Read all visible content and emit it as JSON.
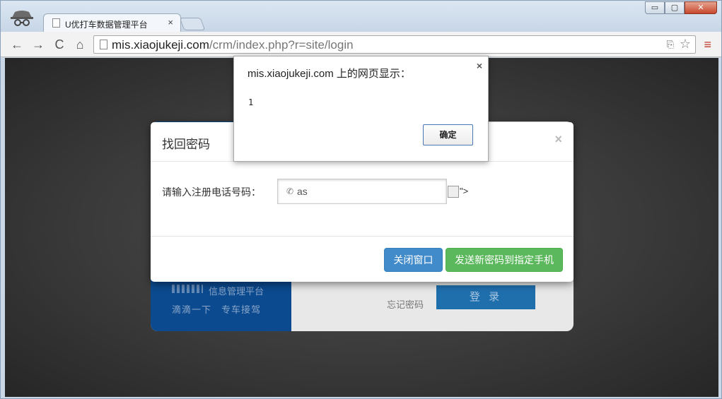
{
  "browser": {
    "tab_title": "U优打车数据管理平台",
    "tab_close": "×",
    "window_buttons": {
      "minimize": "▭",
      "maximize": "▢",
      "close": "✕"
    },
    "url_host": "mis.xiaojukeji.com",
    "url_path": "/crm/index.php?r=site/login",
    "nav": {
      "back": "←",
      "forward": "→",
      "reload": "C",
      "home": "⌂"
    },
    "star": "☆",
    "translate": "⎘",
    "menu": "≡"
  },
  "login": {
    "brand_line1": "信息管理平台",
    "brand_line2": "滴滴一下　专车接驾",
    "forgot_link": "忘记密码",
    "login_button": "登 录"
  },
  "modal": {
    "title": "找回密码",
    "close": "×",
    "phone_label": "请输入注册电话号码：",
    "phone_icon": "✆",
    "phone_value": "as",
    "stray_text": "\">",
    "btn_close": "关闭窗口",
    "btn_send": "发送新密码到指定手机"
  },
  "alert": {
    "title": "mis.xiaojukeji.com 上的网页显示：",
    "close": "×",
    "message": "1",
    "ok": "确定"
  },
  "colors": {
    "primary": "#428bca",
    "success": "#5cb85c",
    "brand_blue": "#0b4a8f"
  }
}
